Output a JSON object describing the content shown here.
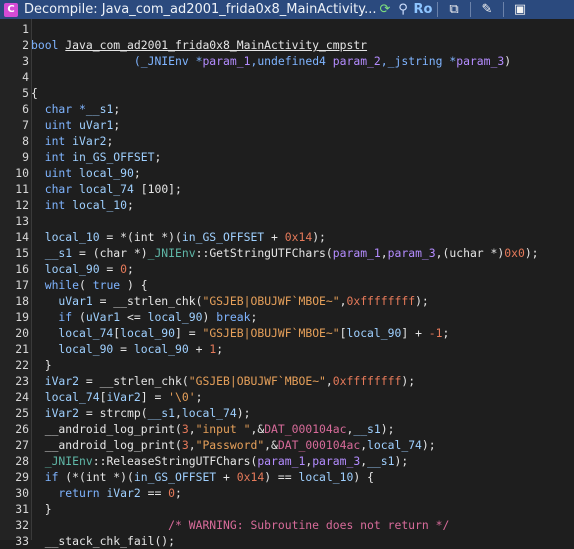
{
  "window": {
    "title": "Decompile: Java_com_ad2001_frida0x8_MainActivity...",
    "read_only_label": "Ro"
  },
  "code_lines": [
    {
      "n": "1",
      "segs": [
        {
          "t": "",
          "c": "plain"
        }
      ]
    },
    {
      "n": "2",
      "segs": [
        {
          "t": "bool ",
          "c": "t"
        },
        {
          "t": "Java_com_ad2001_frida0x8_MainActivity_cmpstr",
          "c": "fhl"
        }
      ]
    },
    {
      "n": "3",
      "segs": [
        {
          "t": "               (_JNIEnv *",
          "c": "t"
        },
        {
          "t": "param_1",
          "c": "p"
        },
        {
          "t": ",undefined4 ",
          "c": "t"
        },
        {
          "t": "param_2",
          "c": "p"
        },
        {
          "t": ",_jstring *",
          "c": "t"
        },
        {
          "t": "param_3",
          "c": "p"
        },
        {
          "t": ")",
          "c": "plain"
        }
      ]
    },
    {
      "n": "4",
      "segs": [
        {
          "t": "",
          "c": "plain"
        }
      ]
    },
    {
      "n": "5",
      "segs": [
        {
          "t": "{",
          "c": "plain"
        }
      ]
    },
    {
      "n": "6",
      "segs": [
        {
          "t": "  char *",
          "c": "t"
        },
        {
          "t": "__s1",
          "c": "v"
        },
        {
          "t": ";",
          "c": "plain"
        }
      ]
    },
    {
      "n": "7",
      "segs": [
        {
          "t": "  uint ",
          "c": "t"
        },
        {
          "t": "uVar1",
          "c": "v"
        },
        {
          "t": ";",
          "c": "plain"
        }
      ]
    },
    {
      "n": "8",
      "segs": [
        {
          "t": "  int ",
          "c": "t"
        },
        {
          "t": "iVar2",
          "c": "v"
        },
        {
          "t": ";",
          "c": "plain"
        }
      ]
    },
    {
      "n": "9",
      "segs": [
        {
          "t": "  int ",
          "c": "t"
        },
        {
          "t": "in_GS_OFFSET",
          "c": "v"
        },
        {
          "t": ";",
          "c": "plain"
        }
      ]
    },
    {
      "n": "10",
      "segs": [
        {
          "t": "  uint ",
          "c": "t"
        },
        {
          "t": "local_90",
          "c": "v"
        },
        {
          "t": ";",
          "c": "plain"
        }
      ]
    },
    {
      "n": "11",
      "segs": [
        {
          "t": "  char ",
          "c": "t"
        },
        {
          "t": "local_74",
          "c": "v"
        },
        {
          "t": " [100];",
          "c": "plain"
        }
      ]
    },
    {
      "n": "12",
      "segs": [
        {
          "t": "  int ",
          "c": "t"
        },
        {
          "t": "local_10",
          "c": "v"
        },
        {
          "t": ";",
          "c": "plain"
        }
      ]
    },
    {
      "n": "13",
      "segs": [
        {
          "t": "",
          "c": "plain"
        }
      ]
    },
    {
      "n": "14",
      "segs": [
        {
          "t": "  local_10",
          "c": "v"
        },
        {
          "t": " = *(int *)(",
          "c": "plain"
        },
        {
          "t": "in_GS_OFFSET",
          "c": "v"
        },
        {
          "t": " + ",
          "c": "plain"
        },
        {
          "t": "0x14",
          "c": "n"
        },
        {
          "t": ");",
          "c": "plain"
        }
      ]
    },
    {
      "n": "15",
      "segs": [
        {
          "t": "  __s1",
          "c": "v"
        },
        {
          "t": " = (char *)",
          "c": "plain"
        },
        {
          "t": "_JNIEnv",
          "c": "g"
        },
        {
          "t": "::GetStringUTFChars(",
          "c": "plain"
        },
        {
          "t": "param_1",
          "c": "p"
        },
        {
          "t": ",",
          "c": "plain"
        },
        {
          "t": "param_3",
          "c": "p"
        },
        {
          "t": ",(uchar *)",
          "c": "plain"
        },
        {
          "t": "0x0",
          "c": "n"
        },
        {
          "t": ");",
          "c": "plain"
        }
      ]
    },
    {
      "n": "16",
      "segs": [
        {
          "t": "  local_90",
          "c": "v"
        },
        {
          "t": " = ",
          "c": "plain"
        },
        {
          "t": "0",
          "c": "n"
        },
        {
          "t": ";",
          "c": "plain"
        }
      ]
    },
    {
      "n": "17",
      "segs": [
        {
          "t": "  while",
          "c": "k"
        },
        {
          "t": "( ",
          "c": "plain"
        },
        {
          "t": "true",
          "c": "k"
        },
        {
          "t": " ) {",
          "c": "plain"
        }
      ]
    },
    {
      "n": "18",
      "segs": [
        {
          "t": "    uVar1",
          "c": "v"
        },
        {
          "t": " = __strlen_chk(",
          "c": "plain"
        },
        {
          "t": "\"GSJEB|OBUJWF`MBOE~\"",
          "c": "s"
        },
        {
          "t": ",",
          "c": "plain"
        },
        {
          "t": "0xffffffff",
          "c": "n"
        },
        {
          "t": ");",
          "c": "plain"
        }
      ]
    },
    {
      "n": "19",
      "segs": [
        {
          "t": "    if",
          "c": "k"
        },
        {
          "t": " (",
          "c": "plain"
        },
        {
          "t": "uVar1",
          "c": "v"
        },
        {
          "t": " <= ",
          "c": "plain"
        },
        {
          "t": "local_90",
          "c": "v"
        },
        {
          "t": ") ",
          "c": "plain"
        },
        {
          "t": "break",
          "c": "k"
        },
        {
          "t": ";",
          "c": "plain"
        }
      ]
    },
    {
      "n": "20",
      "segs": [
        {
          "t": "    local_74",
          "c": "v"
        },
        {
          "t": "[",
          "c": "plain"
        },
        {
          "t": "local_90",
          "c": "v"
        },
        {
          "t": "] = ",
          "c": "plain"
        },
        {
          "t": "\"GSJEB|OBUJWF`MBOE~\"",
          "c": "s"
        },
        {
          "t": "[",
          "c": "plain"
        },
        {
          "t": "local_90",
          "c": "v"
        },
        {
          "t": "] + ",
          "c": "plain"
        },
        {
          "t": "-1",
          "c": "n"
        },
        {
          "t": ";",
          "c": "plain"
        }
      ]
    },
    {
      "n": "21",
      "segs": [
        {
          "t": "    local_90",
          "c": "v"
        },
        {
          "t": " = ",
          "c": "plain"
        },
        {
          "t": "local_90",
          "c": "v"
        },
        {
          "t": " + ",
          "c": "plain"
        },
        {
          "t": "1",
          "c": "n"
        },
        {
          "t": ";",
          "c": "plain"
        }
      ]
    },
    {
      "n": "22",
      "segs": [
        {
          "t": "  }",
          "c": "plain"
        }
      ]
    },
    {
      "n": "23",
      "segs": [
        {
          "t": "  iVar2",
          "c": "v"
        },
        {
          "t": " = __strlen_chk(",
          "c": "plain"
        },
        {
          "t": "\"GSJEB|OBUJWF`MBOE~\"",
          "c": "s"
        },
        {
          "t": ",",
          "c": "plain"
        },
        {
          "t": "0xffffffff",
          "c": "n"
        },
        {
          "t": ");",
          "c": "plain"
        }
      ]
    },
    {
      "n": "24",
      "segs": [
        {
          "t": "  local_74",
          "c": "v"
        },
        {
          "t": "[",
          "c": "plain"
        },
        {
          "t": "iVar2",
          "c": "v"
        },
        {
          "t": "] = ",
          "c": "plain"
        },
        {
          "t": "'\\0'",
          "c": "s"
        },
        {
          "t": ";",
          "c": "plain"
        }
      ]
    },
    {
      "n": "25",
      "segs": [
        {
          "t": "  iVar2",
          "c": "v"
        },
        {
          "t": " = strcmp(",
          "c": "plain"
        },
        {
          "t": "__s1",
          "c": "v"
        },
        {
          "t": ",",
          "c": "plain"
        },
        {
          "t": "local_74",
          "c": "v"
        },
        {
          "t": ");",
          "c": "plain"
        }
      ]
    },
    {
      "n": "26",
      "segs": [
        {
          "t": "  __android_log_print(",
          "c": "plain"
        },
        {
          "t": "3",
          "c": "n"
        },
        {
          "t": ",",
          "c": "plain"
        },
        {
          "t": "\"input \"",
          "c": "s"
        },
        {
          "t": ",&",
          "c": "plain"
        },
        {
          "t": "DAT_000104ac",
          "c": "c"
        },
        {
          "t": ",",
          "c": "plain"
        },
        {
          "t": "__s1",
          "c": "v"
        },
        {
          "t": ");",
          "c": "plain"
        }
      ]
    },
    {
      "n": "27",
      "segs": [
        {
          "t": "  __android_log_print(",
          "c": "plain"
        },
        {
          "t": "3",
          "c": "n"
        },
        {
          "t": ",",
          "c": "plain"
        },
        {
          "t": "\"Password\"",
          "c": "s"
        },
        {
          "t": ",&",
          "c": "plain"
        },
        {
          "t": "DAT_000104ac",
          "c": "c"
        },
        {
          "t": ",",
          "c": "plain"
        },
        {
          "t": "local_74",
          "c": "v"
        },
        {
          "t": ");",
          "c": "plain"
        }
      ]
    },
    {
      "n": "28",
      "segs": [
        {
          "t": "  _JNIEnv",
          "c": "g"
        },
        {
          "t": "::ReleaseStringUTFChars(",
          "c": "plain"
        },
        {
          "t": "param_1",
          "c": "p"
        },
        {
          "t": ",",
          "c": "plain"
        },
        {
          "t": "param_3",
          "c": "p"
        },
        {
          "t": ",",
          "c": "plain"
        },
        {
          "t": "__s1",
          "c": "v"
        },
        {
          "t": ");",
          "c": "plain"
        }
      ]
    },
    {
      "n": "29",
      "segs": [
        {
          "t": "  if",
          "c": "k"
        },
        {
          "t": " (*(int *)(",
          "c": "plain"
        },
        {
          "t": "in_GS_OFFSET",
          "c": "v"
        },
        {
          "t": " + ",
          "c": "plain"
        },
        {
          "t": "0x14",
          "c": "n"
        },
        {
          "t": ") == ",
          "c": "plain"
        },
        {
          "t": "local_10",
          "c": "v"
        },
        {
          "t": ") {",
          "c": "plain"
        }
      ]
    },
    {
      "n": "30",
      "segs": [
        {
          "t": "    return",
          "c": "k"
        },
        {
          "t": " ",
          "c": "plain"
        },
        {
          "t": "iVar2",
          "c": "v"
        },
        {
          "t": " == ",
          "c": "plain"
        },
        {
          "t": "0",
          "c": "n"
        },
        {
          "t": ";",
          "c": "plain"
        }
      ]
    },
    {
      "n": "31",
      "segs": [
        {
          "t": "  }",
          "c": "plain"
        }
      ]
    },
    {
      "n": "32",
      "segs": [
        {
          "t": "                    /* WARNING: Subroutine does not return */",
          "c": "c"
        }
      ]
    },
    {
      "n": "33",
      "segs": [
        {
          "t": "  __stack_chk_fail();",
          "c": "plain"
        }
      ]
    }
  ]
}
